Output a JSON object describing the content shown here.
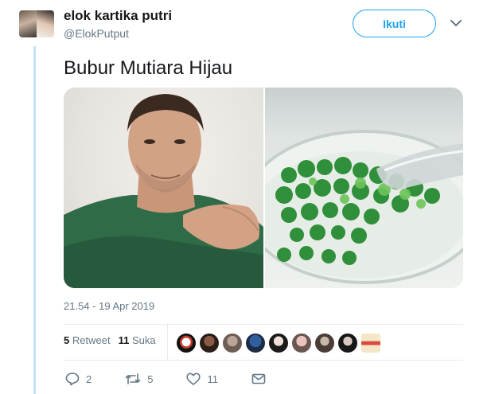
{
  "user": {
    "name": "elok kartika putri",
    "handle": "@ElokPutput"
  },
  "follow_label": "Ikuti",
  "tweet_text": "Bubur Mutiara Hijau",
  "timestamp": "21.54 - 19 Apr 2019",
  "stats": {
    "retweets": "5",
    "retweets_label": "Retweet",
    "likes": "11",
    "likes_label": "Suka"
  },
  "actions": {
    "reply_count": "2",
    "retweet_count": "5",
    "like_count": "11"
  },
  "colors": {
    "accent": "#1da1f2",
    "thread_line": "#c4e2f7",
    "muted": "#657786"
  },
  "icons": [
    "chevron-down-icon",
    "reply-icon",
    "retweet-icon",
    "heart-icon",
    "mail-icon"
  ]
}
